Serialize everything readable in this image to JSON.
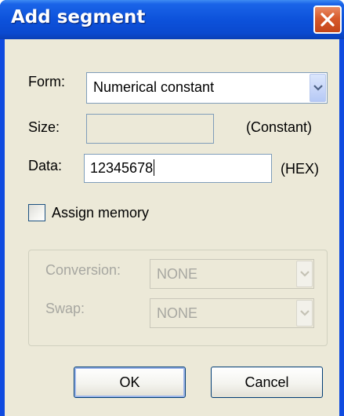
{
  "window": {
    "title": "Add segment"
  },
  "form": {
    "form_label": "Form:",
    "form_value": "Numerical constant",
    "size_label": "Size:",
    "size_value": "",
    "size_hint": "(Constant)",
    "data_label": "Data:",
    "data_value": "12345678",
    "data_hint": "(HEX)"
  },
  "assign_memory": {
    "label": "Assign memory",
    "checked": false
  },
  "memory_group": {
    "enabled": false,
    "conversion_label": "Conversion:",
    "conversion_value": "NONE",
    "swap_label": "Swap:",
    "swap_value": "NONE"
  },
  "buttons": {
    "ok_label": "OK",
    "cancel_label": "Cancel"
  },
  "icons": {
    "close": "close-icon",
    "dropdown": "chevron-down-icon"
  },
  "colors": {
    "titlebar": "#0a49cf",
    "dialog_face": "#ece9d8",
    "close_button": "#d75a2b",
    "disabled_text": "#a7a7a1"
  }
}
